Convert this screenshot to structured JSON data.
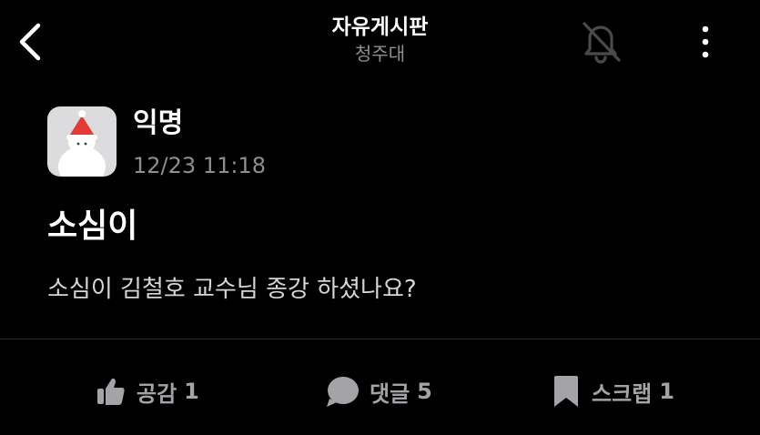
{
  "header": {
    "title": "자유게시판",
    "subtitle": "청주대"
  },
  "post": {
    "author": "익명",
    "timestamp": "12/23 11:18",
    "title": "소심이",
    "body": "소심이 김철호 교수님 종강 하셨나요?"
  },
  "actions": {
    "like_label": "공감",
    "like_count": "1",
    "comment_label": "댓글",
    "comment_count": "5",
    "scrap_label": "스크랩",
    "scrap_count": "1"
  },
  "colors": {
    "background": "#000000",
    "text": "#ffffff",
    "muted": "#8e8e93",
    "action": "#a3a3a8",
    "avatar_bg": "#dcdcdf",
    "santa_hat": "#e53935"
  },
  "icons": [
    "chevron-left-icon",
    "bell-off-icon",
    "more-vertical-icon",
    "thumbs-up-icon",
    "chat-bubble-icon",
    "bookmark-icon"
  ]
}
